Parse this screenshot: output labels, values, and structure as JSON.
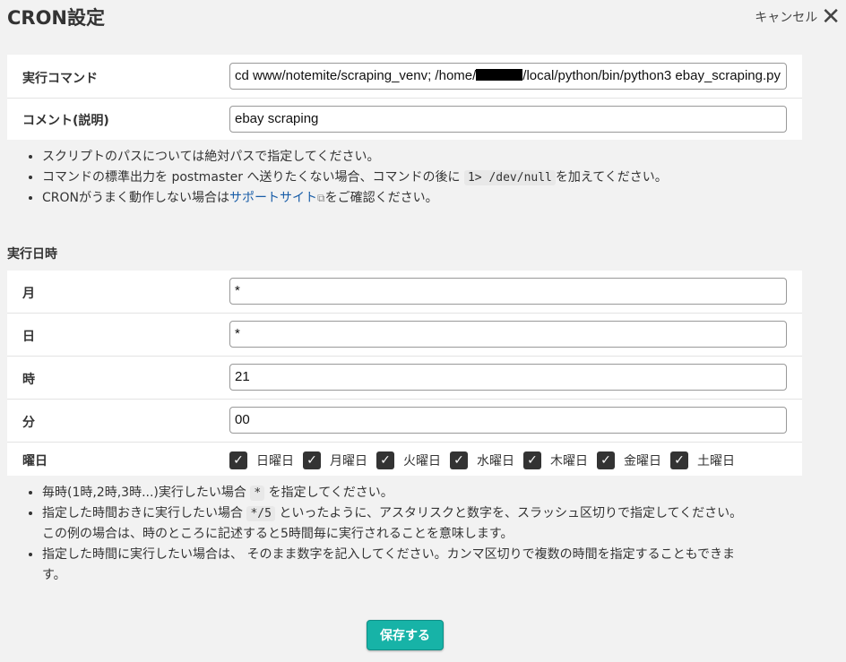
{
  "header": {
    "title": "CRON設定",
    "cancel_label": "キャンセル"
  },
  "command_panel": {
    "command_label": "実行コマンド",
    "command_prefix": "cd www/notemite/scraping_venv; /home/",
    "command_suffix": "/local/python/bin/python3 ebay_scraping.py",
    "comment_label": "コメント(説明)",
    "comment_value": "ebay scraping"
  },
  "command_notes": {
    "note1": "スクリプトのパスについては絶対パスで指定してください。",
    "note2_before": "コマンドの標準出力を postmaster へ送りたくない場合、コマンドの後に",
    "note2_code": "1> /dev/null",
    "note2_after": "を加えてください。",
    "note3_before": "CRONがうまく動作しない場合は",
    "note3_link": "サポートサイト",
    "note3_after": "をご確認ください。"
  },
  "schedule": {
    "section_title": "実行日時",
    "month_label": "月",
    "month_value": "*",
    "day_label": "日",
    "day_value": "*",
    "hour_label": "時",
    "hour_value": "21",
    "minute_label": "分",
    "minute_value": "00",
    "weekday_label": "曜日",
    "weekdays": [
      {
        "label": "日曜日",
        "checked": true
      },
      {
        "label": "月曜日",
        "checked": true
      },
      {
        "label": "火曜日",
        "checked": true
      },
      {
        "label": "水曜日",
        "checked": true
      },
      {
        "label": "木曜日",
        "checked": true
      },
      {
        "label": "金曜日",
        "checked": true
      },
      {
        "label": "土曜日",
        "checked": true
      }
    ]
  },
  "schedule_notes": {
    "note1_before": "毎時(1時,2時,3時...)実行したい場合",
    "note1_code": "*",
    "note1_after": "を指定してください。",
    "note2_before": "指定した時間おきに実行したい場合",
    "note2_code": "*/5",
    "note2_after": "といったように、アスタリスクと数字を、スラッシュ区切りで指定してください。",
    "note2_line2": "この例の場合は、時のところに記述すると5時間毎に実行されることを意味します。",
    "note3_line1": "指定した時間に実行したい場合は、 そのまま数字を記入してください。カンマ区切りで複数の時間を指定することもできま",
    "note3_line2": "す。"
  },
  "actions": {
    "save_label": "保存する"
  },
  "icons": {
    "cancel": "close-x-icon",
    "external_link": "external-link-icon",
    "checkbox": "checkmark-icon"
  },
  "colors": {
    "save_button": "#17b3a7",
    "link": "#1a5ea8",
    "checkbox": "#333333"
  }
}
